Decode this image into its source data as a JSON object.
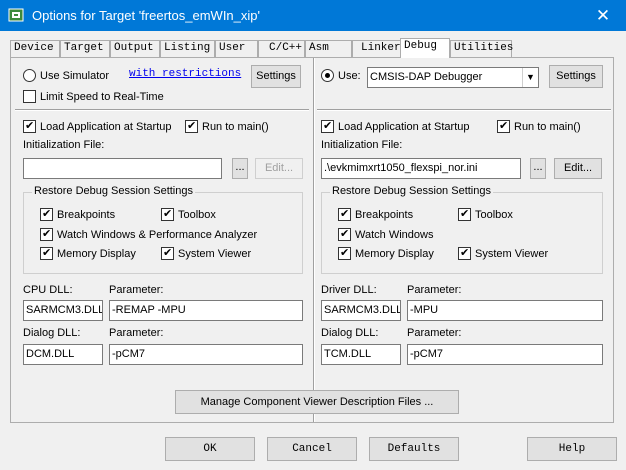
{
  "window": {
    "title": "Options for Target 'freertos_emWIn_xip'",
    "close_glyph": "✕",
    "app_icon": "target-options-icon"
  },
  "tabs": [
    {
      "label": "Device"
    },
    {
      "label": "Target"
    },
    {
      "label": "Output"
    },
    {
      "label": "Listing"
    },
    {
      "label": "User"
    },
    {
      "label": "C/C++"
    },
    {
      "label": "Asm"
    },
    {
      "label": "Linker"
    },
    {
      "label": "Debug",
      "active": true
    },
    {
      "label": "Utilities"
    }
  ],
  "left": {
    "use_simulator_label": "Use Simulator",
    "restrictions_link": "with restrictions",
    "settings_label": "Settings",
    "limit_speed_label": "Limit Speed to Real-Time",
    "load_app_label": "Load Application at Startup",
    "run_main_label": "Run to main()",
    "init_file_label": "Initialization File:",
    "init_file_value": "",
    "browse_label": "...",
    "edit_label": "Edit...",
    "restore_group_title": "Restore Debug Session Settings",
    "breakpoints_label": "Breakpoints",
    "toolbox_label": "Toolbox",
    "watch_label": "Watch Windows & Performance Analyzer",
    "memory_label": "Memory Display",
    "sysviewer_label": "System Viewer",
    "cpu_dll_label": "CPU DLL:",
    "cpu_param_label": "Parameter:",
    "cpu_dll_value": "SARMCM3.DLL",
    "cpu_param_value": "-REMAP -MPU",
    "dialog_dll_label": "Dialog DLL:",
    "dialog_param_label": "Parameter:",
    "dialog_dll_value": "DCM.DLL",
    "dialog_param_value": "-pCM7"
  },
  "right": {
    "use_label": "Use:",
    "debugger_value": "CMSIS-DAP Debugger",
    "settings_label": "Settings",
    "load_app_label": "Load Application at Startup",
    "run_main_label": "Run to main()",
    "init_file_label": "Initialization File:",
    "init_file_value": ".\\evkmimxrt1050_flexspi_nor.ini",
    "browse_label": "...",
    "edit_label": "Edit...",
    "restore_group_title": "Restore Debug Session Settings",
    "breakpoints_label": "Breakpoints",
    "toolbox_label": "Toolbox",
    "watch_label": "Watch Windows",
    "memory_label": "Memory Display",
    "sysviewer_label": "System Viewer",
    "driver_dll_label": "Driver DLL:",
    "driver_param_label": "Parameter:",
    "driver_dll_value": "SARMCM3.DLL",
    "driver_param_value": "-MPU",
    "dialog_dll_label": "Dialog DLL:",
    "dialog_param_label": "Parameter:",
    "dialog_dll_value": "TCM.DLL",
    "dialog_param_value": "-pCM7"
  },
  "manage_button_label": "Manage Component Viewer Description Files ...",
  "footer": {
    "ok": "OK",
    "cancel": "Cancel",
    "defaults": "Defaults",
    "help": "Help"
  },
  "check_glyph": "✔",
  "colors": {
    "titlebar": "#0078d7",
    "link": "#0000ee"
  }
}
